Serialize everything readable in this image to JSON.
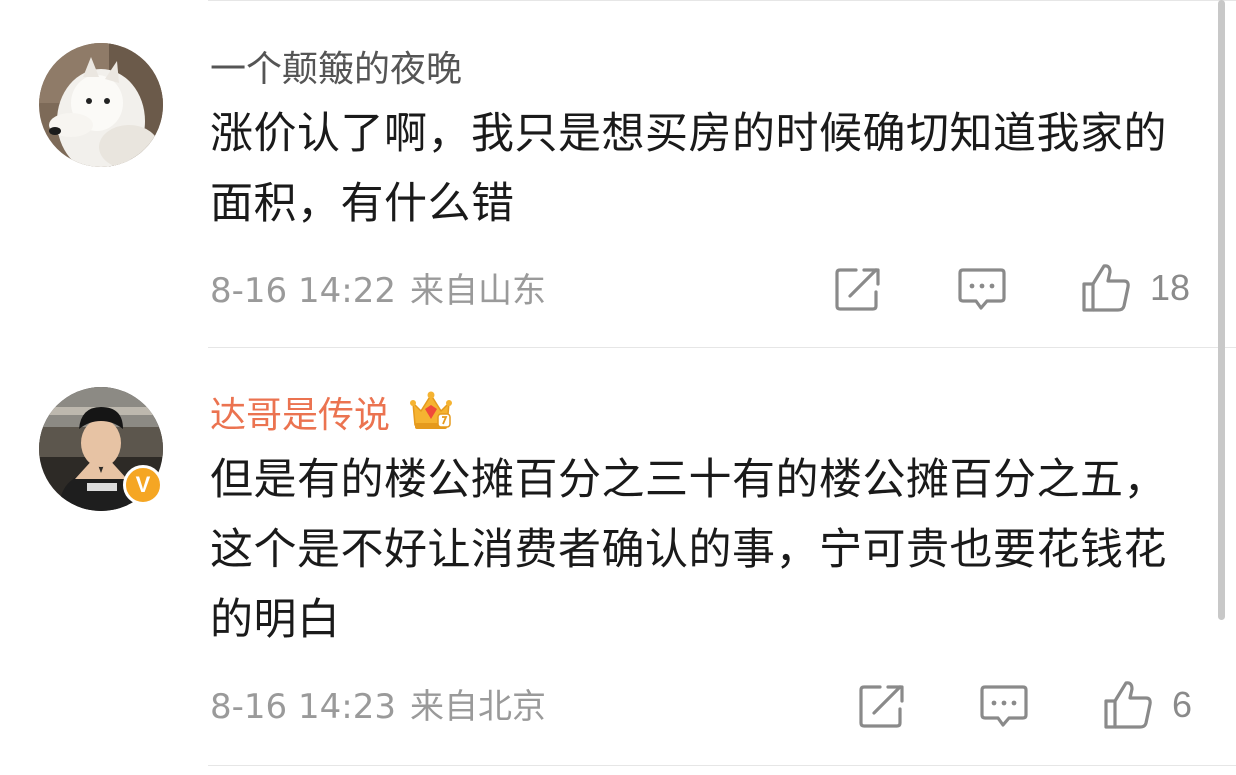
{
  "comments": [
    {
      "username": "一个颠簸的夜晚",
      "username_color": "#555555",
      "avatar": "dog-avatar",
      "text": "涨价认了啊，我只是想买房的时候确切知道我家的面积，有什么错",
      "date": "8-16 14:22",
      "location": "来自山东",
      "likes": "18"
    },
    {
      "username": "达哥是传说",
      "username_color": "#eb7350",
      "avatar": "man-avatar",
      "vip_icon": "crown-icon",
      "verified_badge": "V",
      "text": "但是有的楼公摊百分之三十有的楼公摊百分之五，这个是不好让消费者确认的事，宁可贵也要花钱花的明白",
      "date": "8-16 14:23",
      "location": "来自北京",
      "likes": "6"
    }
  ],
  "icons": {
    "share": "share-icon",
    "comment": "comment-icon",
    "like": "like-icon"
  },
  "colors": {
    "meta_text": "#9a9a9a",
    "icon_gray": "#8a8a8a",
    "vip_orange": "#eb7350",
    "badge_yellow": "#f5a623"
  }
}
